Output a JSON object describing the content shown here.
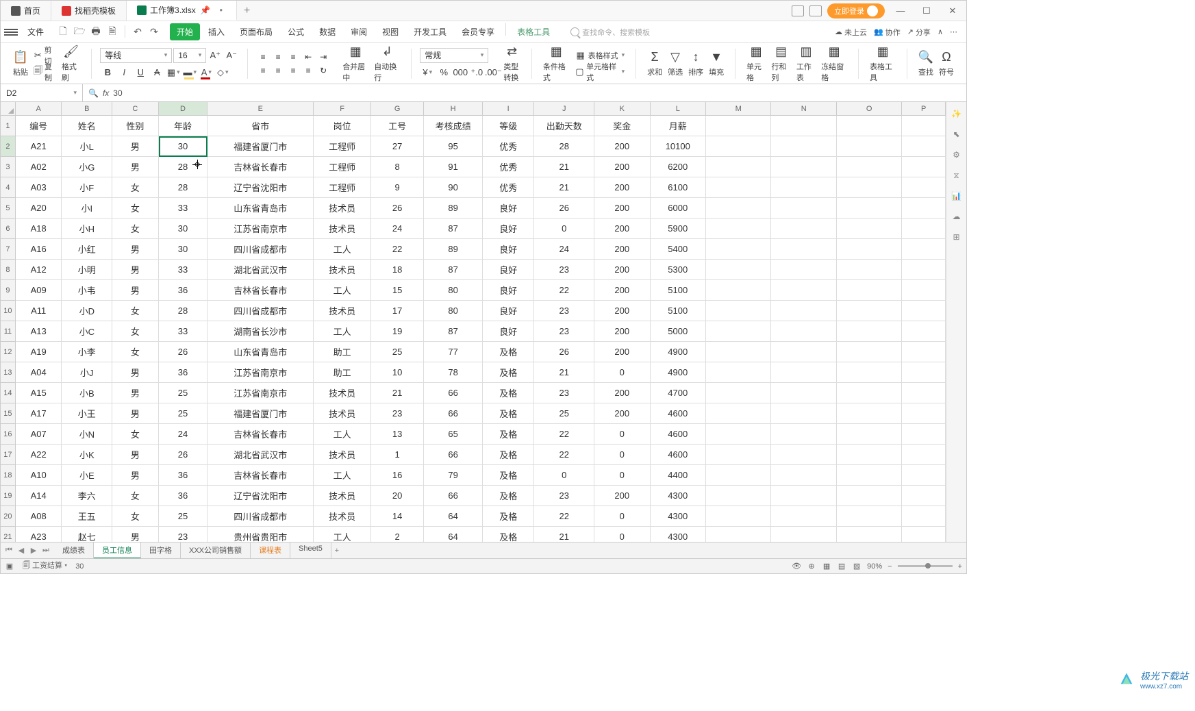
{
  "titlebar": {
    "tabs": [
      {
        "label": "首页",
        "icon": "home"
      },
      {
        "label": "找稻壳模板",
        "icon": "doke"
      },
      {
        "label": "工作簿3.xlsx",
        "icon": "sheet",
        "active": true
      }
    ],
    "login": "立即登录"
  },
  "menubar": {
    "file": "文件",
    "items": [
      "开始",
      "插入",
      "页面布局",
      "公式",
      "数据",
      "审阅",
      "视图",
      "开发工具",
      "会员专享"
    ],
    "table_tools": "表格工具",
    "active": "开始",
    "search_placeholder": "查找命令、搜索模板",
    "right": {
      "cloud": "未上云",
      "coop": "协作",
      "share": "分享"
    }
  },
  "ribbon": {
    "paste": "粘贴",
    "cut": "剪切",
    "copy": "复制",
    "format_painter": "格式刷",
    "font_name": "等线",
    "font_size": "16",
    "merge": "合并居中",
    "wrap": "自动换行",
    "number_format": "常规",
    "type_convert": "类型转换",
    "cond_fmt": "条件格式",
    "table_style": "表格样式",
    "cell_style": "单元格样式",
    "sum": "求和",
    "filter": "筛选",
    "sort": "排序",
    "fill": "填充",
    "cells": "单元格",
    "rows_cols": "行和列",
    "worksheet": "工作表",
    "freeze": "冻结窗格",
    "table_tools": "表格工具",
    "find": "查找",
    "symbol": "符号"
  },
  "formula_bar": {
    "cell_ref": "D2",
    "value": "30"
  },
  "grid": {
    "col_letters": [
      "A",
      "B",
      "C",
      "D",
      "E",
      "F",
      "G",
      "H",
      "I",
      "J",
      "K",
      "L",
      "M",
      "N",
      "O",
      "P"
    ],
    "headers": [
      "编号",
      "姓名",
      "性别",
      "年龄",
      "省市",
      "岗位",
      "工号",
      "考核成绩",
      "等级",
      "出勤天数",
      "奖金",
      "月薪"
    ],
    "selected": {
      "row": 2,
      "col": "D"
    },
    "rows": [
      [
        "A21",
        "小L",
        "男",
        "30",
        "福建省厦门市",
        "工程师",
        "27",
        "95",
        "优秀",
        "28",
        "200",
        "10100"
      ],
      [
        "A02",
        "小G",
        "男",
        "28",
        "吉林省长春市",
        "工程师",
        "8",
        "91",
        "优秀",
        "21",
        "200",
        "6200"
      ],
      [
        "A03",
        "小F",
        "女",
        "28",
        "辽宁省沈阳市",
        "工程师",
        "9",
        "90",
        "优秀",
        "21",
        "200",
        "6100"
      ],
      [
        "A20",
        "小I",
        "女",
        "33",
        "山东省青岛市",
        "技术员",
        "26",
        "89",
        "良好",
        "26",
        "200",
        "6000"
      ],
      [
        "A18",
        "小H",
        "女",
        "30",
        "江苏省南京市",
        "技术员",
        "24",
        "87",
        "良好",
        "0",
        "200",
        "5900"
      ],
      [
        "A16",
        "小红",
        "男",
        "30",
        "四川省成都市",
        "工人",
        "22",
        "89",
        "良好",
        "24",
        "200",
        "5400"
      ],
      [
        "A12",
        "小明",
        "男",
        "33",
        "湖北省武汉市",
        "技术员",
        "18",
        "87",
        "良好",
        "23",
        "200",
        "5300"
      ],
      [
        "A09",
        "小韦",
        "男",
        "36",
        "吉林省长春市",
        "工人",
        "15",
        "80",
        "良好",
        "22",
        "200",
        "5100"
      ],
      [
        "A11",
        "小D",
        "女",
        "28",
        "四川省成都市",
        "技术员",
        "17",
        "80",
        "良好",
        "23",
        "200",
        "5100"
      ],
      [
        "A13",
        "小C",
        "女",
        "33",
        "湖南省长沙市",
        "工人",
        "19",
        "87",
        "良好",
        "23",
        "200",
        "5000"
      ],
      [
        "A19",
        "小李",
        "女",
        "26",
        "山东省青岛市",
        "助工",
        "25",
        "77",
        "及格",
        "26",
        "200",
        "4900"
      ],
      [
        "A04",
        "小J",
        "男",
        "36",
        "江苏省南京市",
        "助工",
        "10",
        "78",
        "及格",
        "21",
        "0",
        "4900"
      ],
      [
        "A15",
        "小B",
        "男",
        "25",
        "江苏省南京市",
        "技术员",
        "21",
        "66",
        "及格",
        "23",
        "200",
        "4700"
      ],
      [
        "A17",
        "小王",
        "男",
        "25",
        "福建省厦门市",
        "技术员",
        "23",
        "66",
        "及格",
        "25",
        "200",
        "4600"
      ],
      [
        "A07",
        "小N",
        "女",
        "24",
        "吉林省长春市",
        "工人",
        "13",
        "65",
        "及格",
        "22",
        "0",
        "4600"
      ],
      [
        "A22",
        "小K",
        "男",
        "26",
        "湖北省武汉市",
        "技术员",
        "1",
        "66",
        "及格",
        "22",
        "0",
        "4600"
      ],
      [
        "A10",
        "小E",
        "男",
        "36",
        "吉林省长春市",
        "工人",
        "16",
        "79",
        "及格",
        "0",
        "0",
        "4400"
      ],
      [
        "A14",
        "李六",
        "女",
        "36",
        "辽宁省沈阳市",
        "技术员",
        "20",
        "66",
        "及格",
        "23",
        "200",
        "4300"
      ],
      [
        "A08",
        "王五",
        "女",
        "25",
        "四川省成都市",
        "技术员",
        "14",
        "64",
        "及格",
        "22",
        "0",
        "4300"
      ],
      [
        "A23",
        "赵七",
        "男",
        "23",
        "贵州省贵阳市",
        "工人",
        "2",
        "64",
        "及格",
        "21",
        "0",
        "4300"
      ]
    ]
  },
  "sheet_tabs": {
    "tabs": [
      "成绩表",
      "员工信息",
      "田字格",
      "XXX公司销售额",
      "课程表",
      "Sheet5"
    ],
    "active": "员工信息",
    "orange": "课程表"
  },
  "statusbar": {
    "mode": "工资结算",
    "value": "30",
    "zoom": "90%"
  },
  "watermark": {
    "text": "极光下载站",
    "url": "www.xz7.com"
  }
}
